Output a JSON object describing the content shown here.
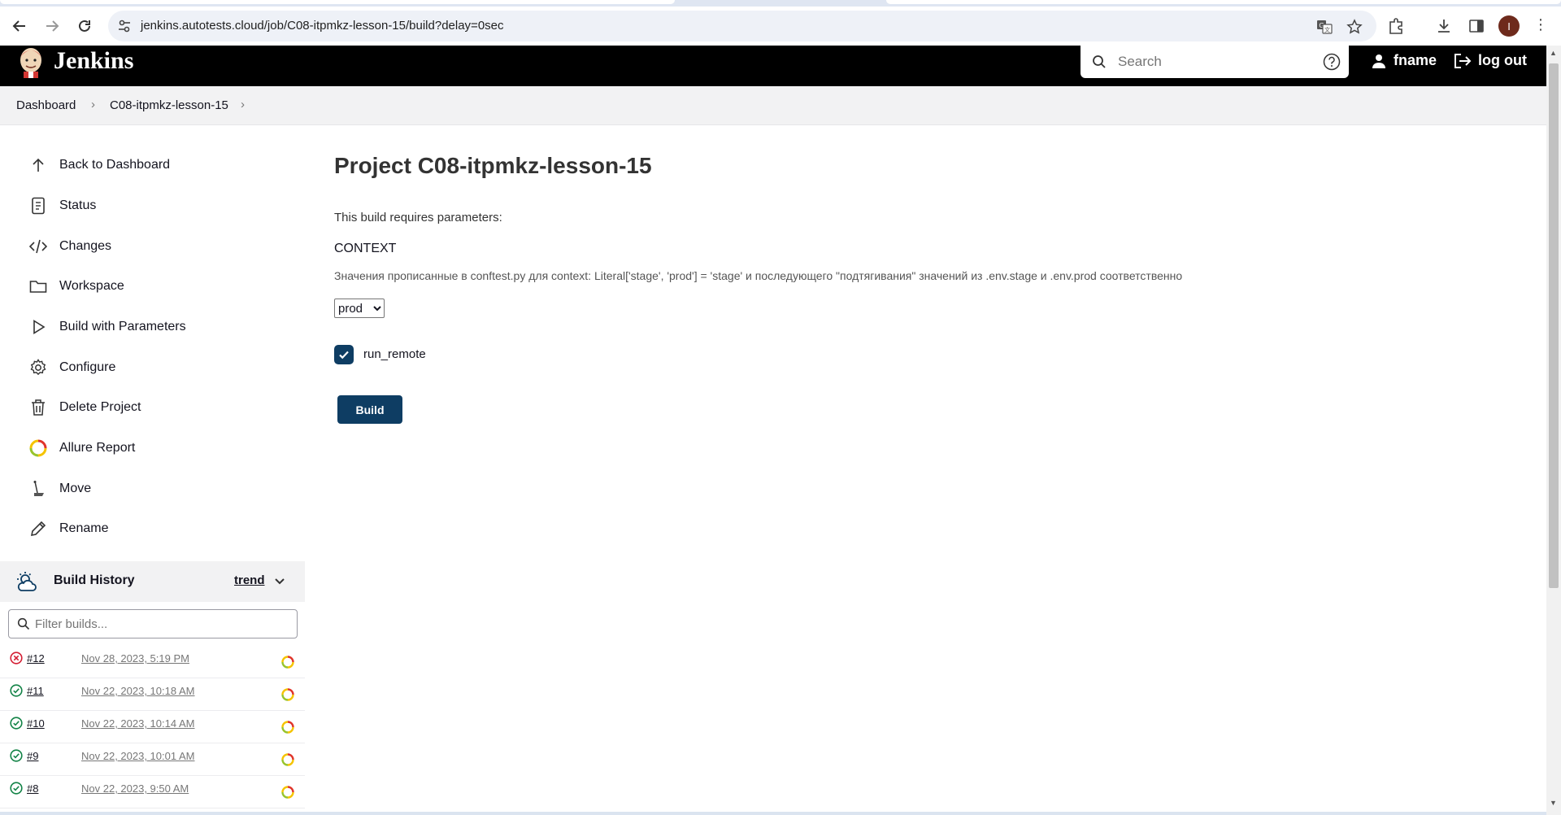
{
  "browser": {
    "url": "jenkins.autotests.cloud/job/C08-itpmkz-lesson-15/build?delay=0sec",
    "profile_initial": "I"
  },
  "header": {
    "brand": "Jenkins",
    "search_placeholder": "Search",
    "user": "fname",
    "logout": "log out"
  },
  "breadcrumb": {
    "items": [
      "Dashboard",
      "C08-itpmkz-lesson-15"
    ]
  },
  "sidebar": {
    "items": [
      {
        "label": "Back to Dashboard",
        "icon": "arrow-up-icon"
      },
      {
        "label": "Status",
        "icon": "document-icon"
      },
      {
        "label": "Changes",
        "icon": "code-icon"
      },
      {
        "label": "Workspace",
        "icon": "folder-icon"
      },
      {
        "label": "Build with Parameters",
        "icon": "play-icon"
      },
      {
        "label": "Configure",
        "icon": "gear-icon"
      },
      {
        "label": "Delete Project",
        "icon": "trash-icon"
      },
      {
        "label": "Allure Report",
        "icon": "allure-icon"
      },
      {
        "label": "Move",
        "icon": "move-icon"
      },
      {
        "label": "Rename",
        "icon": "pencil-icon"
      }
    ]
  },
  "build_history": {
    "title": "Build History",
    "trend": "trend",
    "filter_placeholder": "Filter builds...",
    "builds": [
      {
        "number": "#12",
        "date": "Nov 28, 2023, 5:19 PM",
        "status": "failed"
      },
      {
        "number": "#11",
        "date": "Nov 22, 2023, 10:18 AM",
        "status": "success"
      },
      {
        "number": "#10",
        "date": "Nov 22, 2023, 10:14 AM",
        "status": "success"
      },
      {
        "number": "#9",
        "date": "Nov 22, 2023, 10:01 AM",
        "status": "success"
      },
      {
        "number": "#8",
        "date": "Nov 22, 2023, 9:50 AM",
        "status": "success"
      }
    ]
  },
  "main": {
    "title": "Project C08-itpmkz-lesson-15",
    "intro": "This build requires parameters:",
    "param_name": "CONTEXT",
    "param_description": "Значения прописанные в conftest.py для context: Literal['stage', 'prod'] = 'stage' и последующего \"подтягивания\" значений из .env.stage и .env.prod соответственно",
    "param_value": "prod",
    "checkbox_label": "run_remote",
    "checkbox_checked": true,
    "build_button": "Build"
  },
  "colors": {
    "accent": "#0e3d63",
    "header_bg": "#000000",
    "failed": "#d41f34",
    "success": "#138347"
  }
}
